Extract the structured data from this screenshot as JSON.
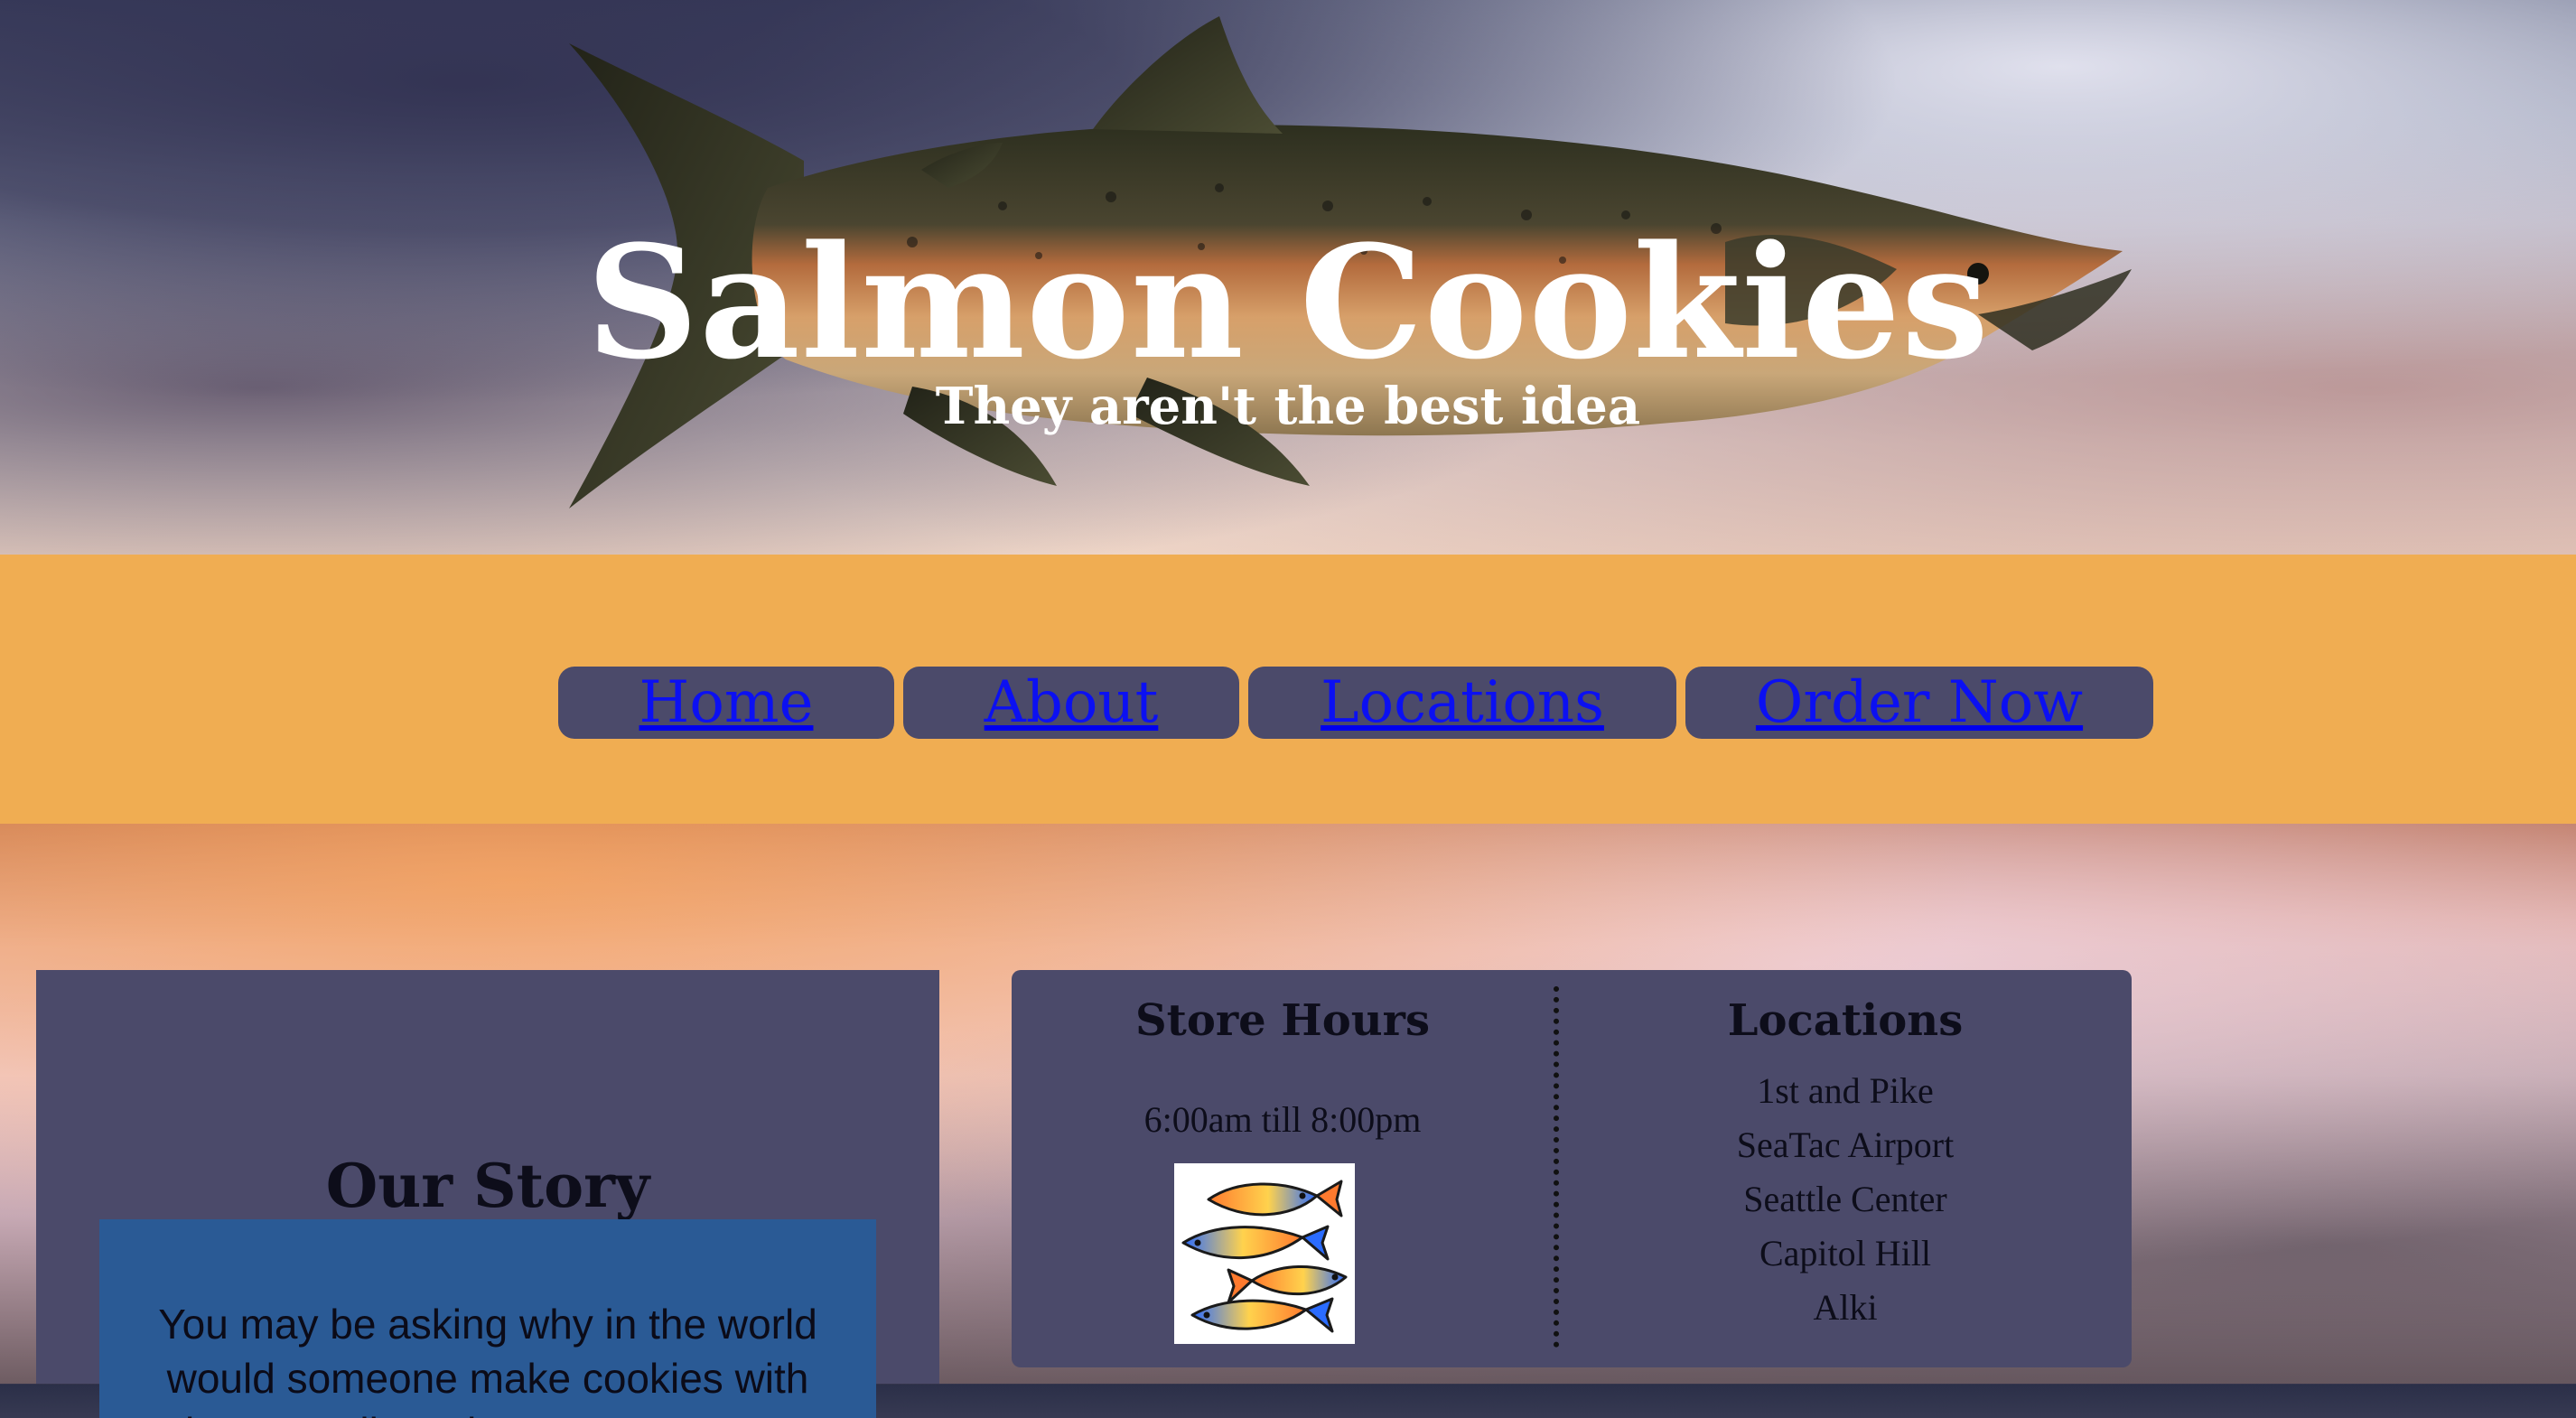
{
  "header": {
    "title": "Salmon Cookies",
    "subtitle": "They aren't the best idea"
  },
  "nav": {
    "items": [
      {
        "label": "Home"
      },
      {
        "label": "About"
      },
      {
        "label": "Locations"
      },
      {
        "label": "Order Now"
      }
    ]
  },
  "story": {
    "title": "Our Story",
    "text": "You may be asking why in the world would someone make cookies with salmon. Well, I'm here to answer your"
  },
  "info": {
    "hours_title": "Store Hours",
    "hours": "6:00am till 8:00pm",
    "locations_title": "Locations",
    "locations": [
      "1st and Pike",
      "SeaTac Airport",
      "Seattle Center",
      "Capitol Hill",
      "Alki"
    ]
  },
  "colors": {
    "nav_band": "#f0ad52",
    "panel": "#4b4a6a",
    "story_box": "#2a5a95",
    "nav_link": "#0b10f2"
  }
}
